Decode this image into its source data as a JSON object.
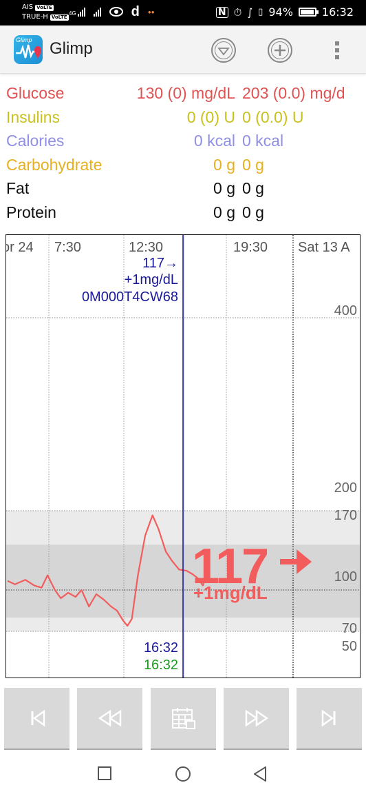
{
  "status_bar": {
    "carrier1": "AIS",
    "carrier2": "TRUE-H",
    "volte_badge": "VoLTE",
    "network": "4G",
    "battery_text": "94%",
    "battery_level": 0.94,
    "time": "16:32",
    "icons": [
      "nfc-icon",
      "alarm-icon",
      "bluetooth-icon",
      "vibrate-icon",
      "eye-icon",
      "d-app-icon"
    ]
  },
  "app_bar": {
    "logo_text": "Glimp",
    "title": "Glimp",
    "actions": [
      "down-circle-icon",
      "add-circle-icon",
      "overflow-menu-icon"
    ]
  },
  "summary": {
    "rows": [
      {
        "label": "Glucose",
        "value1": "130 (0) mg/dL",
        "value2": "203 (0.0) mg/d",
        "color": "#e05252"
      },
      {
        "label": "Insulins",
        "value1": "0 (0) U",
        "value2": "0 (0.0) U",
        "color": "#c9c11e"
      },
      {
        "label": "Calories",
        "value1": "0 kcal",
        "value2": "0 kcal",
        "color": "#8f8fe6"
      },
      {
        "label": "Carbohydrate",
        "value1": "0 g",
        "value2": "0 g",
        "color": "#e6b020"
      },
      {
        "label": "Fat",
        "value1": "0 g",
        "value2": "0 g",
        "color": "#111111"
      },
      {
        "label": "Protein",
        "value1": "0 g",
        "value2": "0 g",
        "color": "#111111"
      }
    ]
  },
  "chart": {
    "time_labels": [
      "or 24",
      "7:30",
      "12:30",
      "19:30",
      "Sat 13 A"
    ],
    "y_labels": [
      "400",
      "200",
      "170",
      "100",
      "70",
      "50"
    ],
    "cursor_reading": {
      "value_arrow": "117→",
      "delta": "+1mg/dL",
      "sensor_id": "0M000T4CW68"
    },
    "cursor_times": {
      "time_blue": "16:32",
      "time_green": "16:32"
    },
    "current_value": "117",
    "current_delta": "+1mg/dL",
    "colors": {
      "glucose_line": "#f25c5c",
      "cursor": "#1a1a99",
      "target_band": "#d6d6d6",
      "range_band": "#ebebeb",
      "big_value": "#f25c5c",
      "time_green": "#1a9a1a"
    }
  },
  "chart_data": {
    "type": "line",
    "title": "",
    "xlabel": "",
    "ylabel": "",
    "x_tick_labels": [
      "or 24",
      "7:30",
      "12:30",
      "19:30",
      "Sat 13 A"
    ],
    "y_ticks": [
      50,
      70,
      100,
      170,
      200,
      400
    ],
    "ylim": [
      45,
      470
    ],
    "bands": [
      {
        "from": 70,
        "to": 170,
        "color": "#ebebeb"
      },
      {
        "from": 80,
        "to": 140,
        "color": "#d6d6d6"
      }
    ],
    "grid": true,
    "series": [
      {
        "color": "#f25c5c",
        "x_hours": [
          4.0,
          4.5,
          5.2,
          5.8,
          6.3,
          6.7,
          7.2,
          7.6,
          8.1,
          8.6,
          9.0,
          9.5,
          10.0,
          10.5,
          11.0,
          11.4,
          11.8,
          12.1,
          12.4,
          12.8,
          13.3,
          13.8,
          14.2,
          14.7,
          15.1,
          15.6,
          16.1,
          16.5,
          16.9,
          17.2,
          17.6
        ],
        "values": [
          108,
          105,
          109,
          104,
          102,
          113,
          100,
          94,
          98,
          95,
          100,
          88,
          97,
          93,
          88,
          85,
          78,
          74,
          79,
          112,
          148,
          166,
          154,
          134,
          126,
          118,
          117,
          114,
          110,
          104,
          117
        ]
      }
    ]
  },
  "buttons": {
    "first": "first-page-icon",
    "rewind": "rewind-icon",
    "calendar": "calendar-icon",
    "forward": "fast-forward-icon",
    "last": "last-page-icon"
  },
  "system_nav": [
    "recent-apps-icon",
    "home-icon",
    "back-icon"
  ]
}
